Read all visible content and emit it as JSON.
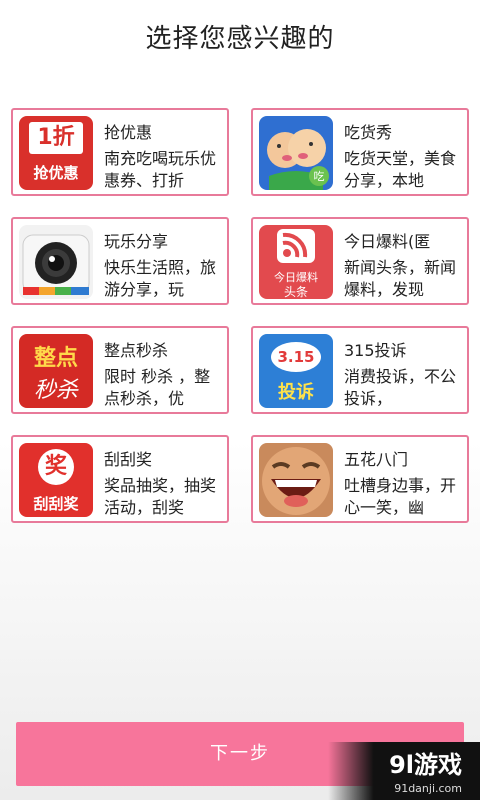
{
  "header": {
    "title": "选择您感兴趣的"
  },
  "cards": [
    {
      "name": "抢优惠",
      "desc": "南充吃喝玩乐优惠券、打折",
      "icon": "discount-icon",
      "icon_text_1": "1折",
      "icon_text_2": "抢优惠"
    },
    {
      "name": "吃货秀",
      "desc": "吃货天堂，美食分享，本地",
      "icon": "foodie-icon",
      "icon_text_1": "吃"
    },
    {
      "name": "玩乐分享",
      "desc": "快乐生活照，旅游分享，玩",
      "icon": "camera-icon"
    },
    {
      "name": "今日爆料(匿",
      "desc": "新闻头条，新闻爆料，发现",
      "icon": "rss-icon",
      "icon_text_1": "今日爆料",
      "icon_text_2": "头条"
    },
    {
      "name": "整点秒杀",
      "desc": "限时 秒杀 ，整点秒杀，优",
      "icon": "flash-sale-icon",
      "icon_text_1": "整点",
      "icon_text_2": "秒杀"
    },
    {
      "name": "315投诉",
      "desc": "消费投诉，不公投诉，",
      "icon": "complaint-icon",
      "icon_text_1": "3.15",
      "icon_text_2": "投诉"
    },
    {
      "name": "刮刮奖",
      "desc": "奖品抽奖，抽奖活动，刮奖",
      "icon": "scratch-card-icon",
      "icon_text_1": "奖",
      "icon_text_2": "刮刮奖"
    },
    {
      "name": "五花八门",
      "desc": "吐槽身边事，开心一笑，幽",
      "icon": "laughing-face-icon"
    }
  ],
  "footer": {
    "next_label": "下一步"
  },
  "watermark": {
    "brand": "9l游戏",
    "url": "91danji.com"
  }
}
